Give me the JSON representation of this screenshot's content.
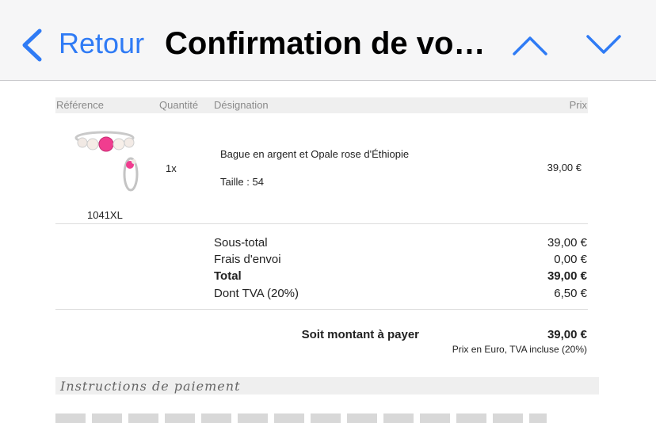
{
  "navbar": {
    "back_label": "Retour",
    "title": "Confirmation de votre commande",
    "accent": "#2f7bf5"
  },
  "table": {
    "headers": {
      "reference": "Référence",
      "quantity": "Quantité",
      "designation": "Désignation",
      "price": "Prix"
    },
    "item": {
      "reference": "1041XL",
      "quantity": "1x",
      "designation": "Bague en argent et Opale rose d'Éthiopie",
      "size": "Taille :  54",
      "price": "39,00 €"
    }
  },
  "summary": {
    "subtotal_label": "Sous-total",
    "subtotal_value": "39,00 €",
    "shipping_label": "Frais d'envoi",
    "shipping_value": "0,00 €",
    "total_label": "Total",
    "total_value": "39,00 €",
    "vat_label": "Dont TVA (20%)",
    "vat_value": "6,50 €"
  },
  "payment": {
    "label": "Soit montant à payer",
    "value": "39,00 €",
    "note": "Prix en Euro, TVA incluse (20%)"
  },
  "instructions": {
    "title": "Instructions de paiement"
  }
}
